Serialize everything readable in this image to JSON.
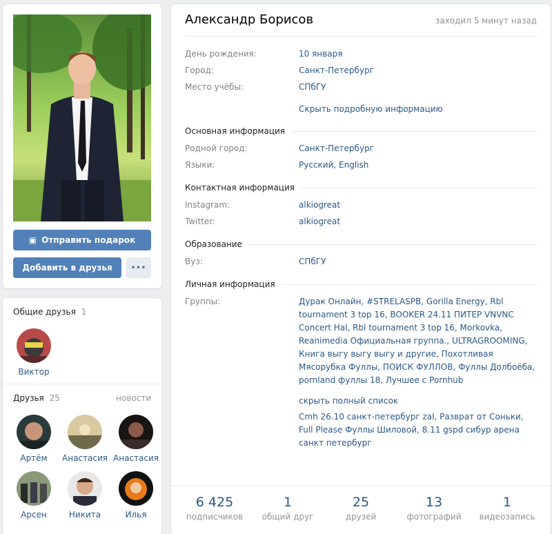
{
  "profile": {
    "name": "Александр Борисов",
    "online": "заходил 5 минут назад"
  },
  "actions": {
    "gift": "Отправить подарок",
    "add_friend": "Добавить в друзья",
    "more": "•••"
  },
  "info": {
    "brief": [
      {
        "label": "День рождения:",
        "value": "10 января"
      },
      {
        "label": "Город:",
        "value": "Санкт-Петербург"
      },
      {
        "label": "Место учёбы:",
        "value": "СПбГУ"
      }
    ],
    "toggle_details": "Скрыть подробную информацию",
    "sections": {
      "main": {
        "title": "Основная информация",
        "rows": [
          {
            "label": "Родной город:",
            "value": "Санкт-Петербург"
          },
          {
            "label": "Языки:",
            "value": "Русский, English"
          }
        ]
      },
      "contacts": {
        "title": "Контактная информация",
        "rows": [
          {
            "label": "Instagram:",
            "value": "alkiogreat"
          },
          {
            "label": "Twitter:",
            "value": "alkiogreat"
          }
        ]
      },
      "education": {
        "title": "Образование",
        "rows": [
          {
            "label": "Вуз:",
            "value": "СПбГУ"
          }
        ]
      },
      "personal": {
        "title": "Личная информация",
        "groups_label": "Группы:",
        "groups": "Дурак Онлайн, #STRELASPB, Gorilla Energy, Rbl tournament 3 top 16, BOOKER 24.11 ПИТЕР VNVNC Concert Hal, Rbl tournament 3 top 16, Morkovka, Reanimedia Официальная группа., ULTRAGROOMING, Книга выгу выгу выгу и другие, Похотливая Мясорубка Фуллы, ПОИСК ФУЛЛОВ, Фуллы Долбоёба, pornland фуллы 18, Лучшее с Pornhub",
        "hide_list": "скрыть полный список",
        "groups_extra": "Cmh 26.10 санкт-петербург zal, Разврат от Соньки, Full Please Фуллы Шиловой, 8.11 gspd сибур арена санкт петербург"
      }
    }
  },
  "counters": [
    {
      "num": "6 425",
      "label": "подписчиков"
    },
    {
      "num": "1",
      "label": "общий друг"
    },
    {
      "num": "25",
      "label": "друзей"
    },
    {
      "num": "13",
      "label": "фотографий"
    },
    {
      "num": "1",
      "label": "видеозапись"
    }
  ],
  "mutual": {
    "title": "Общие друзья",
    "count": "1",
    "friends": [
      {
        "name": "Виктор"
      }
    ]
  },
  "friends": {
    "title": "Друзья",
    "count": "25",
    "link": "новости",
    "items": [
      {
        "name": "Артём"
      },
      {
        "name": "Анастасия"
      },
      {
        "name": "Анастасия"
      },
      {
        "name": "Арсен"
      },
      {
        "name": "Никита"
      },
      {
        "name": "Илья"
      }
    ]
  }
}
